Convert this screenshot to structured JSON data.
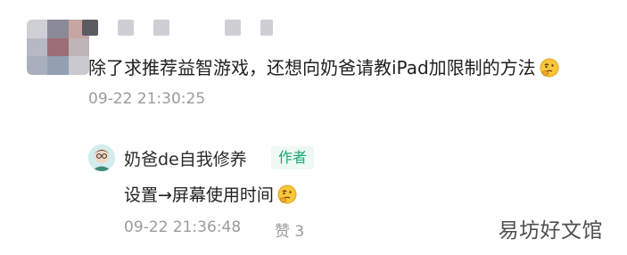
{
  "comment": {
    "text": "除了求推荐益智游戏，还想向奶爸请教iPad加限制的方法",
    "emoji": "thinking-face-icon",
    "timestamp": "09-22 21:30:25"
  },
  "reply": {
    "author": "奶爸de自我修养",
    "badge": "作者",
    "text": "设置→屏幕使用时间",
    "emoji": "thinking-face-icon",
    "timestamp": "09-22 21:36:48",
    "like_label": "赞",
    "like_count": "3"
  },
  "watermark": "易坊好文馆",
  "colors": {
    "badge_text": "#19a974",
    "badge_bg": "#eef9f3",
    "meta_text": "#9b9b9b"
  }
}
